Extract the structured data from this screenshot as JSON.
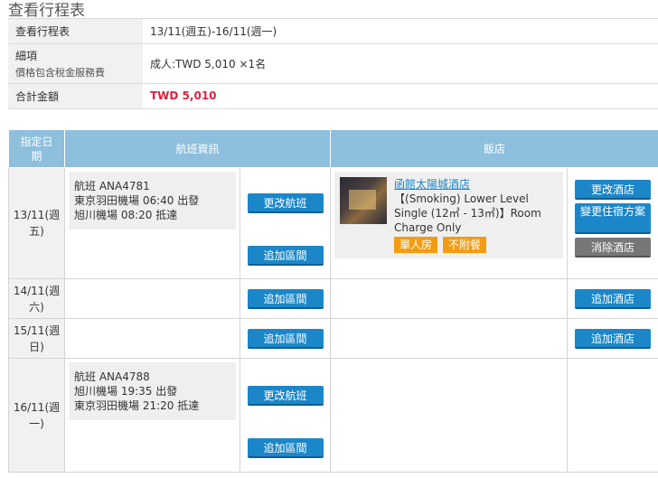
{
  "page_title": "查看行程表",
  "summary": {
    "schedule_label": "查看行程表",
    "schedule_value": "13/11(週五)-16/11(週一)",
    "details_label": "細項",
    "details_sub": "價格包含稅金服務費",
    "details_value": "成人:TWD 5,010 ×1名",
    "total_label": "合計金額",
    "total_value": "TWD 5,010"
  },
  "headers": {
    "date": "指定日期",
    "flight": "航班資訊",
    "hotel": "飯店"
  },
  "buttons": {
    "change_flight": "更改航班",
    "add_segment": "追加區間",
    "change_hotel": "更改酒店",
    "change_room": "變更住宿方案",
    "delete_hotel": "消除酒店",
    "add_hotel": "追加酒店"
  },
  "days": [
    {
      "date": "13/11(週五)",
      "flight": {
        "number": "航班 ANA4781",
        "depart": "東京羽田機場 06:40 出發",
        "arrive": "旭川機場 08:20 抵達"
      },
      "hotel": {
        "name": "函館太陽城酒店",
        "room": "【(Smoking) Lower Level Single (12㎡ - 13㎡)】Room Charge Only",
        "tags": [
          "單人房",
          "不附餐"
        ]
      }
    },
    {
      "date": "14/11(週六)"
    },
    {
      "date": "15/11(週日)"
    },
    {
      "date": "16/11(週一)",
      "flight": {
        "number": "航班 ANA4788",
        "depart": "旭川機場 19:35 出發",
        "arrive": "東京羽田機場 21:20 抵達"
      }
    }
  ]
}
